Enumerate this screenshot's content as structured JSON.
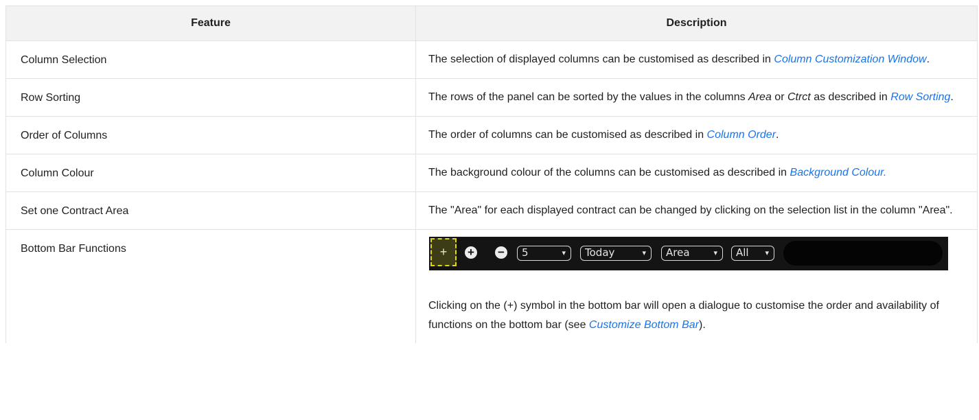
{
  "table": {
    "headers": {
      "feature": "Feature",
      "description": "Description"
    },
    "rows": [
      {
        "feature": "Column Selection",
        "d1": "The selection of displayed columns can be customised as described in ",
        "link": "Column Customization Window",
        "d2": "."
      },
      {
        "feature": "Row Sorting",
        "d1": "The rows of the panel can be sorted by the values in the columns ",
        "em1": "Area",
        "d2": " or ",
        "em2": "Ctrct",
        "d3": " as described in ",
        "link": "Row Sorting",
        "d4": "."
      },
      {
        "feature": "Order of Columns",
        "d1": "The order of columns can be customised as described in ",
        "link": "Column Order",
        "d2": "."
      },
      {
        "feature": "Column Colour",
        "d1": "The background colour of the columns can be customised as described in ",
        "link": "Background Colour.",
        "d2": ""
      },
      {
        "feature": "Set one Contract Area",
        "d1": "The \"Area\" for each displayed contract can be changed by clicking on the selection list in the column \"Area\"."
      },
      {
        "feature": "Bottom Bar Functions",
        "bar": {
          "plus": "+",
          "add_icon": "+",
          "remove_icon": "−",
          "count": "5",
          "period": "Today",
          "area": "Area",
          "filter": "All",
          "caret": "▾"
        },
        "d1": "Clicking on the (+) symbol in the bottom bar will open a dialogue to customise the order and availability of functions on the bottom bar (see ",
        "link": "Customize Bottom Bar",
        "d2": ")."
      }
    ]
  }
}
